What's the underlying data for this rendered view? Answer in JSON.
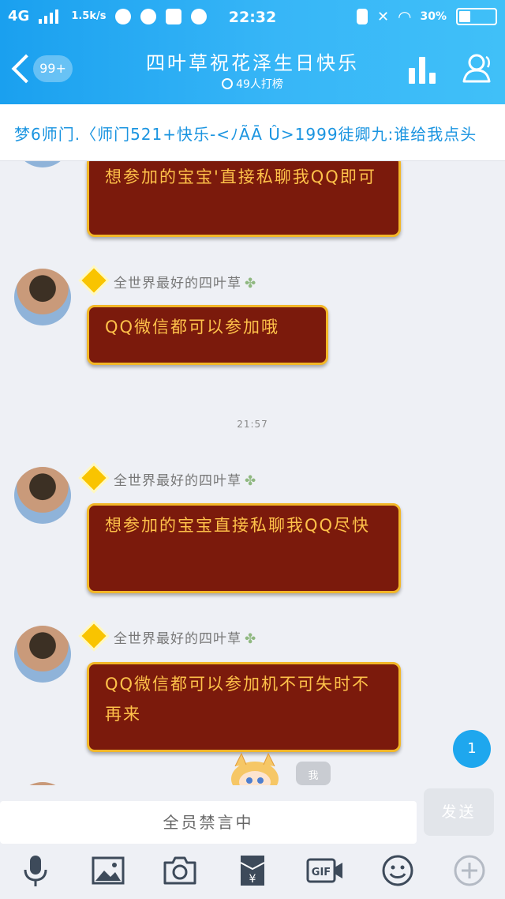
{
  "status_bar": {
    "network": "4G",
    "speed": "1.5k/s",
    "time": "22:32",
    "battery": "30"
  },
  "header": {
    "back_badge": "99+",
    "title": "四叶草祝花泽生日快乐",
    "subtitle": "49人打榜",
    "accent": "#1aa0ef"
  },
  "notice": {
    "text": "梦6师门.〈师门521+快乐-<ﾉÃĀ Û>1999徒卿九:谁给我点头"
  },
  "chat": {
    "messages": [
      {
        "sender": "",
        "text": "想参加的宝宝'直接私聊我QQ即可"
      },
      {
        "sender": "全世界最好的四叶草",
        "text": "QQ微信都可以参加哦"
      },
      {
        "sender": "全世界最好的四叶草",
        "text": "想参加的宝宝直接私聊我QQ尽快"
      },
      {
        "sender": "全世界最好的四叶草",
        "text": "QQ微信都可以参加机不可失时不再来"
      }
    ],
    "timestamp": "21:57",
    "unread_count": "1",
    "sticker_label": "我",
    "bubble_color": "#7b1a0c",
    "bubble_border": "#f2b728",
    "bubble_text_color": "#ffc24a"
  },
  "input": {
    "placeholder": "全员禁言中",
    "send_label": "发送"
  },
  "toolbar": {
    "icons": [
      "microphone-icon",
      "image-icon",
      "camera-icon",
      "red-packet-icon",
      "gif-icon",
      "emoji-icon",
      "plus-icon"
    ]
  }
}
